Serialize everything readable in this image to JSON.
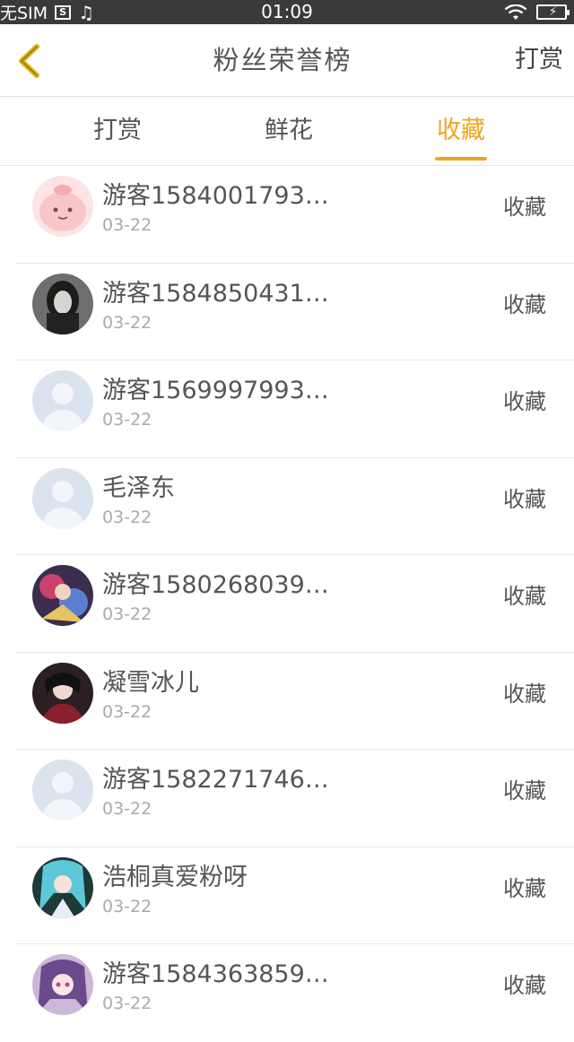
{
  "status_bar": {
    "carrier": "无SIM",
    "sim_icon_glyph": "S",
    "music_glyph": "♫",
    "time": "01:09",
    "battery_glyph": "⚡"
  },
  "header": {
    "back_icon": "chevron-left-icon",
    "title": "粉丝荣誉榜",
    "right_action": "打赏"
  },
  "tabs": [
    {
      "label": "打赏",
      "active": false
    },
    {
      "label": "鲜花",
      "active": false
    },
    {
      "label": "收藏",
      "active": true
    }
  ],
  "colors": {
    "accent": "#f0a31e",
    "statusbar": "#3a3a3a"
  },
  "fans": [
    {
      "name": "游客1584001793…",
      "date": "03-22",
      "action": "收藏",
      "avatar": "pink-cartoon"
    },
    {
      "name": "游客1584850431…",
      "date": "03-22",
      "action": "收藏",
      "avatar": "dark-portrait"
    },
    {
      "name": "游客1569997993…",
      "date": "03-22",
      "action": "收藏",
      "avatar": "default"
    },
    {
      "name": "毛泽东",
      "date": "03-22",
      "action": "收藏",
      "avatar": "default"
    },
    {
      "name": "游客1580268039…",
      "date": "03-22",
      "action": "收藏",
      "avatar": "colorful-anime"
    },
    {
      "name": "凝雪冰儿",
      "date": "03-22",
      "action": "收藏",
      "avatar": "dark-anime"
    },
    {
      "name": "游客1582271746…",
      "date": "03-22",
      "action": "收藏",
      "avatar": "default"
    },
    {
      "name": "浩桐真爱粉呀",
      "date": "03-22",
      "action": "收藏",
      "avatar": "blue-hair-anime"
    },
    {
      "name": "游客1584363859…",
      "date": "03-22",
      "action": "收藏",
      "avatar": "purple-hair-anime"
    }
  ]
}
